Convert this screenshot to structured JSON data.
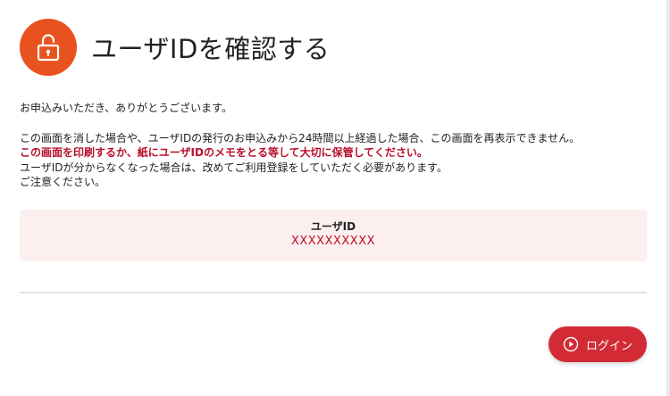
{
  "header": {
    "title": "ユーザIDを確認する",
    "icon": "unlock-icon",
    "icon_bg": "#e8521f"
  },
  "intro": "お申込みいただき、ありがとうございます。",
  "notice": {
    "line1": "この画面を消した場合や、ユーザIDの発行のお申込みから24時間以上経過した場合、この画面を再表示できません。",
    "warning": "この画面を印刷するか、紙にユーザIDのメモをとる等して大切に保管してください。",
    "line3": "ユーザIDが分からなくなった場合は、改めてご利用登録をしていただく必要があります。",
    "line4": "ご注意ください。"
  },
  "user_id": {
    "label": "ユーザID",
    "value": "XXXXXXXXXX"
  },
  "actions": {
    "login_label": "ログイン",
    "login_icon": "play-circle-icon"
  },
  "colors": {
    "accent": "#d22b36",
    "warning_text": "#b7102a",
    "id_box_bg": "#fcefef"
  }
}
